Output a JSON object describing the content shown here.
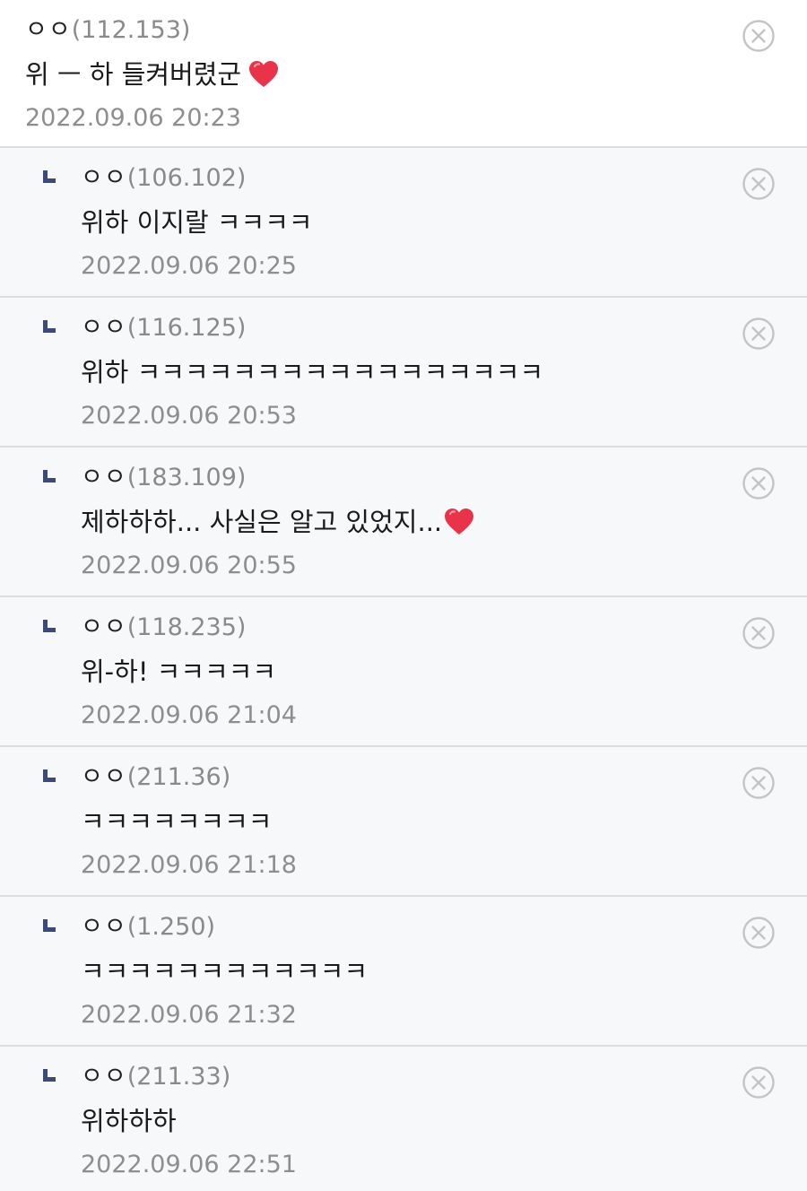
{
  "comments": [
    {
      "nick": "ㅇㅇ",
      "ip": "(112.153)",
      "text": "위 ㅡ 하 들켜버렸군",
      "date": "2022.09.06 20:23",
      "heart": true,
      "reply": false
    },
    {
      "nick": "ㅇㅇ",
      "ip": "(106.102)",
      "text": "위하 이지랄 ㅋㅋㅋㅋ",
      "date": "2022.09.06 20:25",
      "heart": false,
      "reply": true
    },
    {
      "nick": "ㅇㅇ",
      "ip": "(116.125)",
      "text": "위하 ㅋㅋㅋㅋㅋㅋㅋㅋㅋㅋㅋㅋㅋㅋㅋㅋㅋ",
      "date": "2022.09.06 20:53",
      "heart": false,
      "reply": true
    },
    {
      "nick": "ㅇㅇ",
      "ip": "(183.109)",
      "text": "제하하하... 사실은 알고 있었지...",
      "date": "2022.09.06 20:55",
      "heart": true,
      "reply": true
    },
    {
      "nick": "ㅇㅇ",
      "ip": "(118.235)",
      "text": "위-하! ㅋㅋㅋㅋㅋ",
      "date": "2022.09.06 21:04",
      "heart": false,
      "reply": true
    },
    {
      "nick": "ㅇㅇ",
      "ip": "(211.36)",
      "text": "ㅋㅋㅋㅋㅋㅋㅋㅋ",
      "date": "2022.09.06 21:18",
      "heart": false,
      "reply": true
    },
    {
      "nick": "ㅇㅇ",
      "ip": "(1.250)",
      "text": "ㅋㅋㅋㅋㅋㅋㅋㅋㅋㅋㅋㅋ",
      "date": "2022.09.06 21:32",
      "heart": false,
      "reply": true
    },
    {
      "nick": "ㅇㅇ",
      "ip": "(211.33)",
      "text": "위하하하",
      "date": "2022.09.06 22:51",
      "heart": false,
      "reply": true
    }
  ],
  "icons": {
    "delete": "close-circle-icon",
    "reply": "reply-arrow-icon",
    "heart": "heart-emoji-icon"
  },
  "colors": {
    "reply_bg": "#f7f8fa",
    "reply_marker": "#3d4a78",
    "heart": "#e8334a",
    "meta_text": "#8e8e8e"
  }
}
